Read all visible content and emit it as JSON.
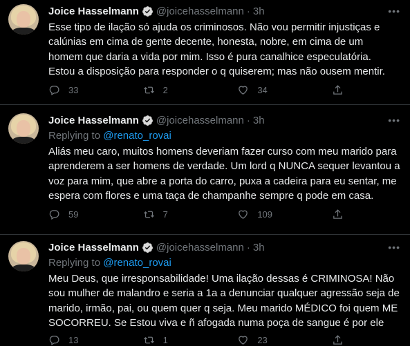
{
  "tweets": [
    {
      "name": "Joice Hasselmann",
      "handle": "@joicehasselmann",
      "dot": "·",
      "time": "3h",
      "replying_prefix": "",
      "replying_to": "",
      "text": "Esse tipo de ilação só ajuda os criminosos. Não vou permitir injustiças e calúnias em cima de gente decente, honesta, nobre, em cima de um homem que daria a vida por mim. Isso é pura canalhice especulatória. Estou a disposição para responder o q quiserem; mas não ousem mentir.",
      "replies": "33",
      "retweets": "2",
      "likes": "34"
    },
    {
      "name": "Joice Hasselmann",
      "handle": "@joicehasselmann",
      "dot": "·",
      "time": "3h",
      "replying_prefix": "Replying to",
      "replying_to": "@renato_rovai",
      "text": "Aliás meu caro, muitos homens deveriam fazer curso com meu marido para aprenderem a ser homens de verdade. Um lord q NUNCA sequer levantou a voz para mim, que abre a porta do carro, puxa a cadeira para eu sentar, me espera com flores e uma taça de champanhe sempre q pode em casa.",
      "replies": "59",
      "retweets": "7",
      "likes": "109"
    },
    {
      "name": "Joice Hasselmann",
      "handle": "@joicehasselmann",
      "dot": "·",
      "time": "3h",
      "replying_prefix": "Replying to",
      "replying_to": "@renato_rovai",
      "text": "Meu Deus, que irresponsabilidade! Uma ilação dessas é CRIMINOSA! Não sou mulher de malandro e seria a 1a a denunciar qualquer agressão seja de marido, irmão, pai, ou quem quer q seja. Meu marido MÉDICO foi quem ME SOCORREU. Se Estou viva e ñ afogada numa poça de sangue é por ele",
      "replies": "13",
      "retweets": "1",
      "likes": "23"
    }
  ],
  "colors": {
    "background": "#000000",
    "text": "#e7e9ea",
    "muted": "#71767b",
    "accent": "#1d9bf0",
    "divider": "#2f3336"
  },
  "icons": [
    "verified-badge-icon",
    "more-icon",
    "reply-icon",
    "retweet-icon",
    "like-icon",
    "share-icon"
  ]
}
